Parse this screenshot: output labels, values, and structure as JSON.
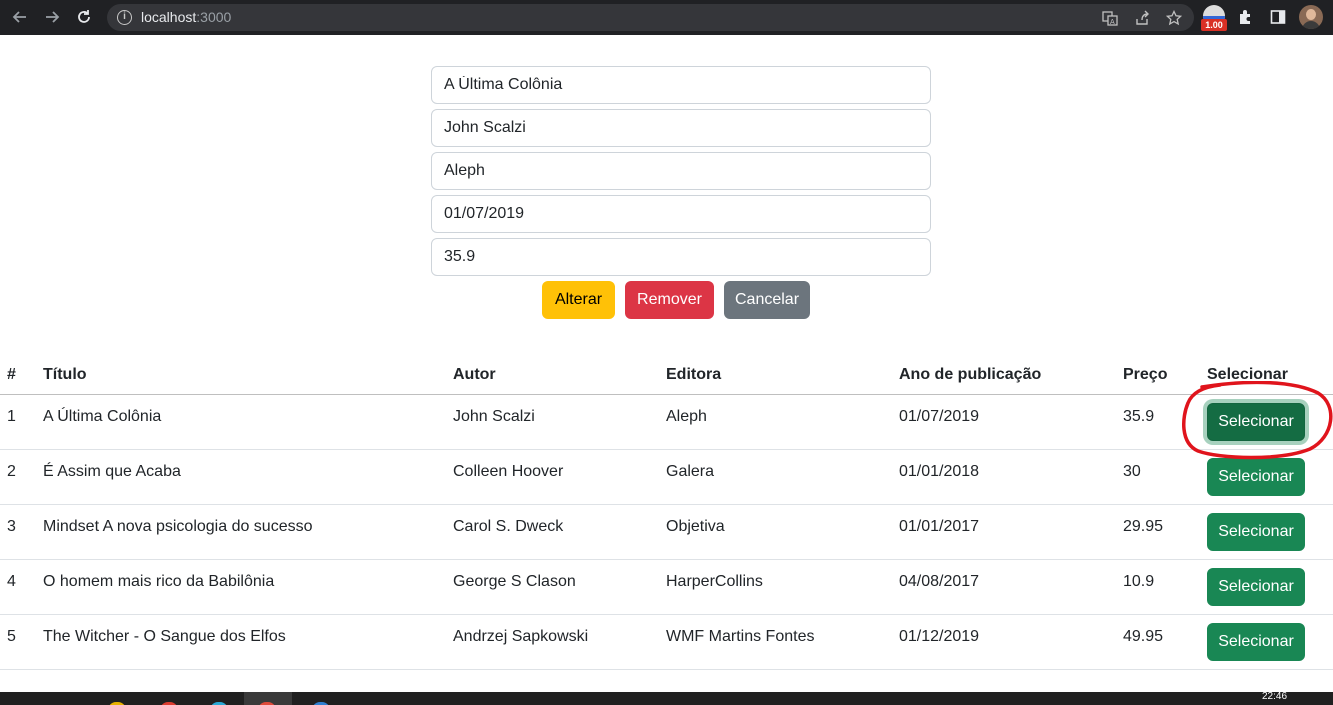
{
  "browser": {
    "url_host": "localhost",
    "url_port": ":3000",
    "extension_badge": "1.00"
  },
  "form": {
    "titulo": "A Última Colônia",
    "autor": "John Scalzi",
    "editora": "Aleph",
    "ano": "01/07/2019",
    "preco": "35.9",
    "buttons": {
      "alterar": "Alterar",
      "remover": "Remover",
      "cancelar": "Cancelar"
    }
  },
  "table": {
    "headers": [
      "#",
      "Título",
      "Autor",
      "Editora",
      "Ano de publicação",
      "Preço",
      "Selecionar"
    ],
    "rows": [
      {
        "id": "1",
        "titulo": "A Última Colônia",
        "autor": "John Scalzi",
        "editora": "Aleph",
        "ano": "01/07/2019",
        "preco": "35.9",
        "button": "Selecionar"
      },
      {
        "id": "2",
        "titulo": "É Assim que Acaba",
        "autor": "Colleen Hoover",
        "editora": "Galera",
        "ano": "01/01/2018",
        "preco": "30",
        "button": "Selecionar"
      },
      {
        "id": "3",
        "titulo": "Mindset A nova psicologia do sucesso",
        "autor": "Carol S. Dweck",
        "editora": "Objetiva",
        "ano": "01/01/2017",
        "preco": "29.95",
        "button": "Selecionar"
      },
      {
        "id": "4",
        "titulo": "O homem mais rico da Babilônia",
        "autor": "George S Clason",
        "editora": "HarperCollins",
        "ano": "04/08/2017",
        "preco": "10.9",
        "button": "Selecionar"
      },
      {
        "id": "5",
        "titulo": "The Witcher - O Sangue dos Elfos",
        "autor": "Andrzej Sapkowski",
        "editora": "WMF Martins Fontes",
        "ano": "01/12/2019",
        "preco": "49.95",
        "button": "Selecionar"
      }
    ]
  },
  "taskbar": {
    "clock": "22:46"
  },
  "colors": {
    "success": "#198754",
    "warning": "#ffc107",
    "danger": "#dc3545",
    "secondary": "#6c757d",
    "annotation": "#e0141c"
  }
}
